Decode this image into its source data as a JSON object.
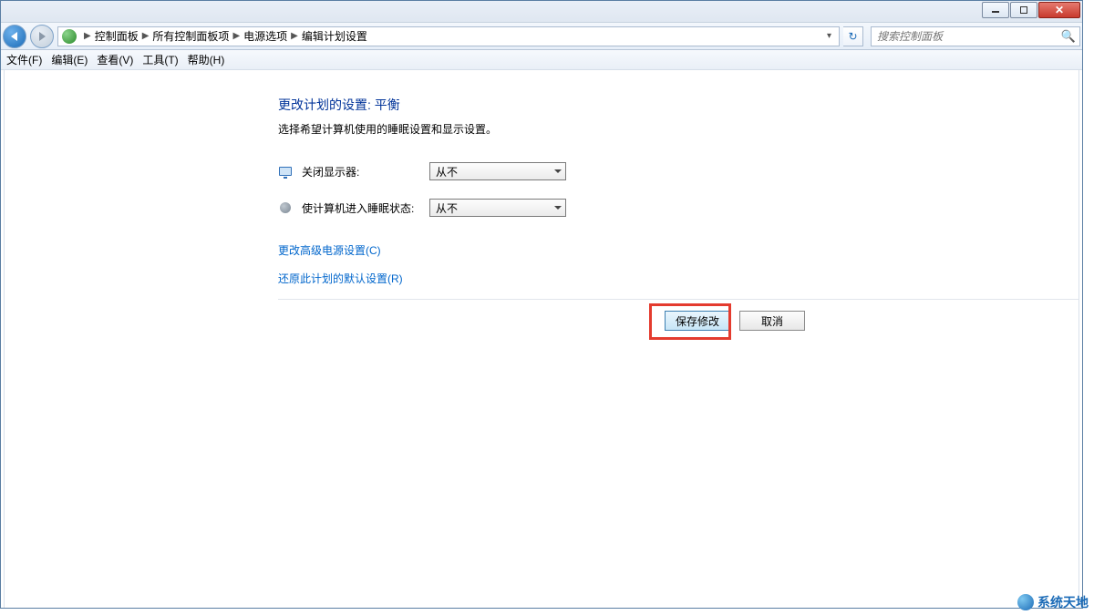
{
  "window": {
    "controls": {
      "minimize": "minimize",
      "maximize": "maximize",
      "close": "close"
    }
  },
  "breadcrumb": {
    "items": [
      "控制面板",
      "所有控制面板项",
      "电源选项",
      "编辑计划设置"
    ]
  },
  "nav": {
    "refresh_tip": "刷新"
  },
  "search": {
    "placeholder": "搜索控制面板"
  },
  "menu": {
    "file": "文件(F)",
    "edit": "编辑(E)",
    "view": "查看(V)",
    "tools": "工具(T)",
    "help": "帮助(H)"
  },
  "page": {
    "title": "更改计划的设置: 平衡",
    "subtitle": "选择希望计算机使用的睡眠设置和显示设置。"
  },
  "settings": {
    "display_off_label": "关闭显示器:",
    "display_off_value": "从不",
    "sleep_label": "使计算机进入睡眠状态:",
    "sleep_value": "从不"
  },
  "links": {
    "advanced": "更改高级电源设置(C)",
    "restore": "还原此计划的默认设置(R)"
  },
  "buttons": {
    "save": "保存修改",
    "cancel": "取消"
  },
  "watermark": "系统天地"
}
